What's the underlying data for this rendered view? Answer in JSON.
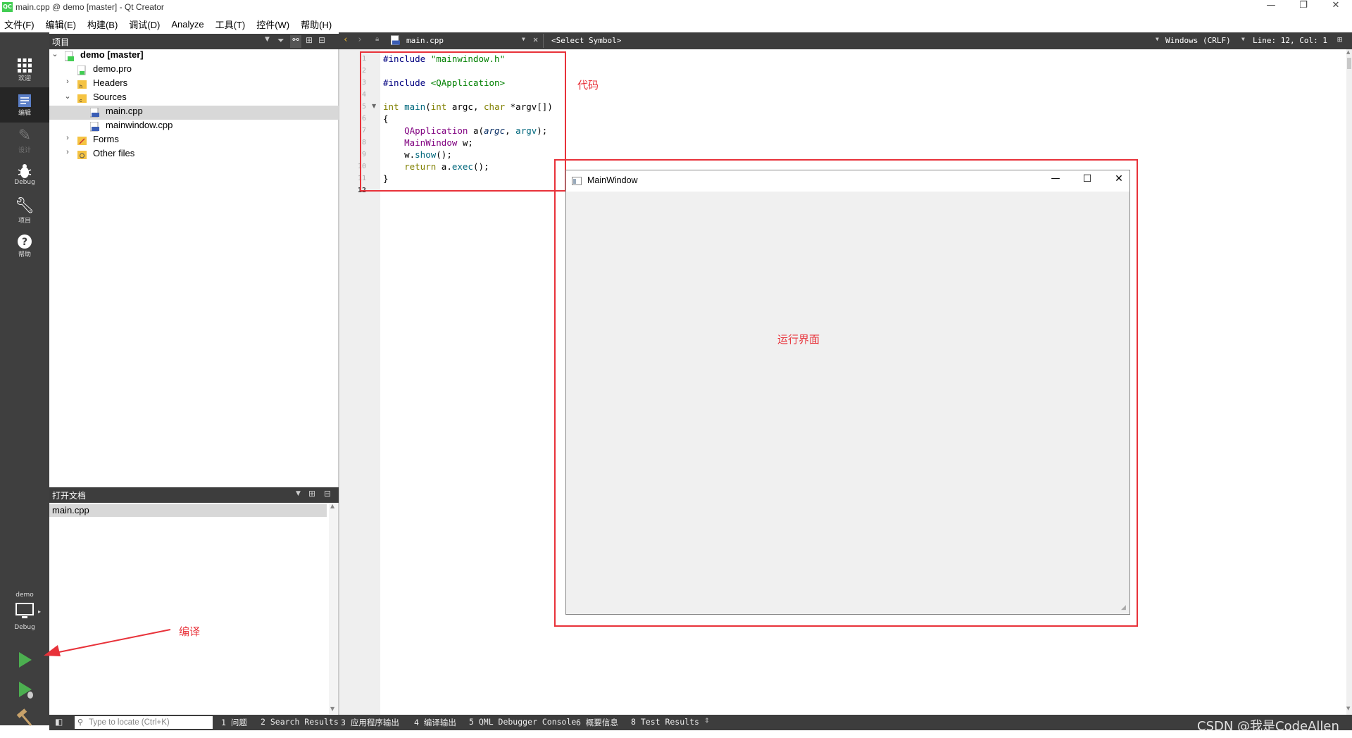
{
  "window": {
    "logo_text": "QC",
    "title": "main.cpp @ demo [master] - Qt Creator",
    "controls": [
      "—",
      "❐",
      "✕"
    ]
  },
  "menubar": [
    "文件(F)",
    "编辑(E)",
    "构建(B)",
    "调试(D)",
    "Analyze",
    "工具(T)",
    "控件(W)",
    "帮助(H)"
  ],
  "modes": [
    {
      "label": "欢迎",
      "icon": "grid-icon"
    },
    {
      "label": "编辑",
      "icon": "edit-doc-icon"
    },
    {
      "label": "设计",
      "icon": "pencil-icon"
    },
    {
      "label": "Debug",
      "icon": "bug-icon"
    },
    {
      "label": "项目",
      "icon": "wrench-icon"
    },
    {
      "label": "帮助",
      "icon": "help-icon"
    }
  ],
  "kit": {
    "project": "demo",
    "build": "Debug"
  },
  "project_panel": {
    "title": "项目",
    "tree": [
      {
        "label": "demo [master]",
        "level": 0,
        "expanded": true,
        "bold": true
      },
      {
        "label": "demo.pro",
        "level": 1
      },
      {
        "label": "Headers",
        "level": 1,
        "expandable": true
      },
      {
        "label": "Sources",
        "level": 1,
        "expanded": true
      },
      {
        "label": "main.cpp",
        "level": 2,
        "selected": true
      },
      {
        "label": "mainwindow.cpp",
        "level": 2
      },
      {
        "label": "Forms",
        "level": 1,
        "expandable": true
      },
      {
        "label": "Other files",
        "level": 1,
        "expandable": true
      }
    ]
  },
  "open_docs": {
    "title": "打开文档",
    "items": [
      "main.cpp"
    ]
  },
  "editor_toolbar": {
    "file": "main.cpp",
    "symbol": "<Select Symbol>",
    "line_ending": "Windows (CRLF)",
    "position": "Line: 12, Col: 1"
  },
  "code": {
    "line_numbers": [
      "1",
      "2",
      "3",
      "4",
      "5",
      "6",
      "7",
      "8",
      "9",
      "10",
      "11",
      "12"
    ],
    "lines": [
      "#include \"mainwindow.h\"",
      "",
      "#include <QApplication>",
      "",
      "int main(int argc, char *argv[])",
      "{",
      "    QApplication a(argc, argv);",
      "    MainWindow w;",
      "    w.show();",
      "    return a.exec();",
      "}",
      ""
    ]
  },
  "run_window": {
    "title": "MainWindow",
    "controls": [
      "—",
      "☐",
      "✕"
    ]
  },
  "annotations": {
    "code": "代码",
    "runtime": "运行界面",
    "compile": "编译"
  },
  "bottombar": {
    "locator_placeholder": "Type to locate (Ctrl+K)",
    "tabs": [
      "1 问题",
      "2 Search Results",
      "3 应用程序输出",
      "4 编译输出",
      "5 QML Debugger Console",
      "6 概要信息",
      "8 Test Results"
    ]
  },
  "watermark": "CSDN @我是CodeAllen",
  "colors": {
    "accent_red": "#e8323a",
    "dark_panel": "#3d3d3d",
    "modebar": "#3f3f3f",
    "run_green": "#4caf50"
  }
}
